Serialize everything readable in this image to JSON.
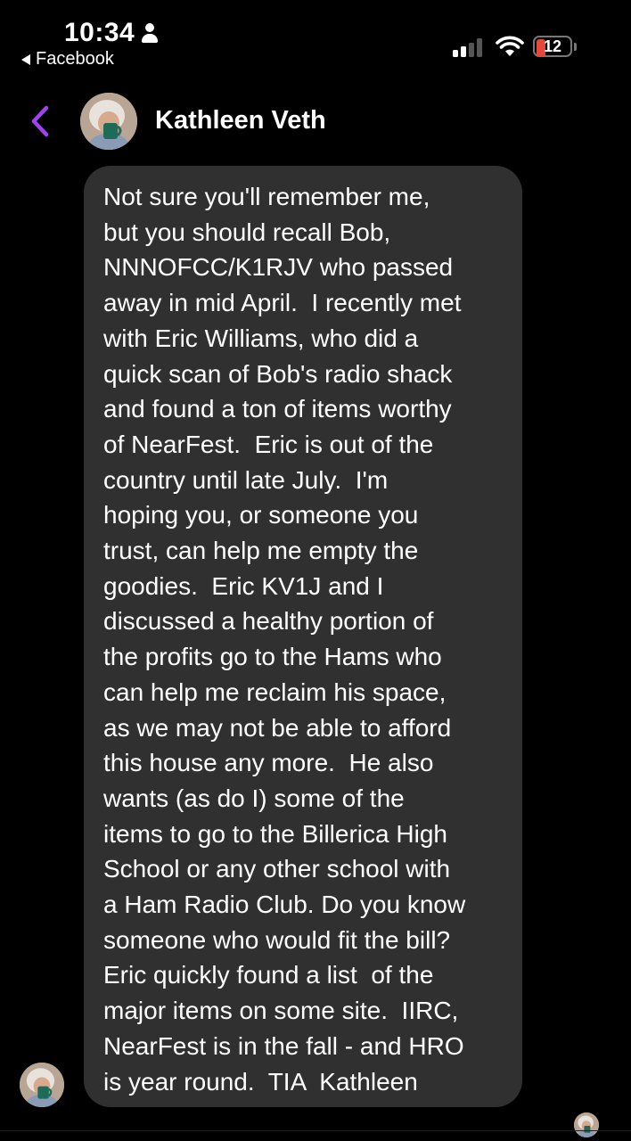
{
  "status_bar": {
    "time": "10:34",
    "back_app_label": "Facebook",
    "battery_level": "12",
    "signal_bars_filled": 2,
    "signal_bars_total": 4,
    "battery_color": "#e5483a"
  },
  "header": {
    "contact_name": "Kathleen Veth",
    "back_icon": "chevron-left-icon",
    "accent_color": "#a042f0"
  },
  "message": {
    "lines": [
      "Not sure you'll remember me,",
      "but you should recall Bob,",
      "NNNOFCC/K1RJV who passed",
      "away in mid April.  I recently met",
      "with Eric Williams, who did a",
      "quick scan of Bob's radio shack",
      "and found a ton of items worthy",
      "of NearFest.  Eric is out of the",
      "country until late July.  I'm",
      "hoping you, or someone you",
      "trust, can help me empty the",
      "goodies.  Eric KV1J and I",
      "discussed a healthy portion of",
      "the profits go to the Hams who",
      "can help me reclaim his space,",
      "as we may not be able to afford",
      "this house any more.  He also",
      "wants (as do I) some of the",
      "items to go to the Billerica High",
      "School or any other school with",
      "a Ham Radio Club. Do you know",
      "someone who would fit the bill?",
      "Eric quickly found a list  of the",
      "major items on some site.  IIRC,",
      "NearFest is in the fall - and HRO",
      "is year round.  TIA  Kathleen"
    ],
    "bubble_color": "#303030"
  }
}
